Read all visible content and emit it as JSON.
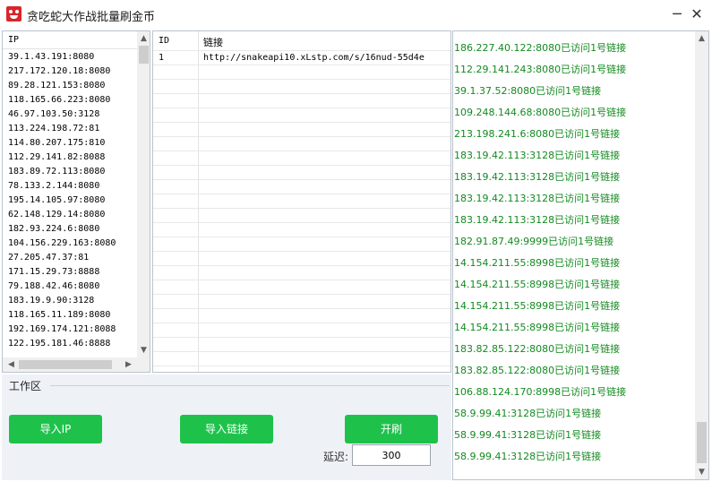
{
  "window": {
    "title": "贪吃蛇大作战批量刷金币",
    "minimize": "─",
    "close": "✕"
  },
  "ip_list": {
    "header": "IP",
    "items": [
      "39.1.43.191:8080",
      "217.172.120.18:8080",
      "89.28.121.153:8080",
      "118.165.66.223:8080",
      "46.97.103.50:3128",
      "113.224.198.72:81",
      "114.80.207.175:810",
      "112.29.141.82:8088",
      "183.89.72.113:8080",
      "78.133.2.144:8080",
      "195.14.105.97:8080",
      "62.148.129.14:8080",
      "182.93.224.6:8080",
      "104.156.229.163:8080",
      "27.205.47.37:81",
      "171.15.29.73:8888",
      "79.188.42.46:8080",
      "183.19.9.90:3128",
      "118.165.11.189:8080",
      "192.169.174.121:8088",
      "122.195.181.46:8888"
    ]
  },
  "link_grid": {
    "col_id": "ID",
    "col_link": "链接",
    "rows": [
      {
        "id": "1",
        "link": "http://snakeapi10.xLstp.com/s/16nud-55d4e"
      }
    ]
  },
  "work_area": {
    "label": "工作区",
    "import_ip_label": "导入IP",
    "import_link_label": "导入链接",
    "start_label": "开刷",
    "delay_label": "延迟:",
    "delay_value": "300"
  },
  "log": {
    "lines": [
      "186.227.40.122:8080已访问1号链接",
      "112.29.141.243:8080已访问1号链接",
      "39.1.37.52:8080已访问1号链接",
      "109.248.144.68:8080已访问1号链接",
      "213.198.241.6:8080已访问1号链接",
      "183.19.42.113:3128已访问1号链接",
      "183.19.42.113:3128已访问1号链接",
      "183.19.42.113:3128已访问1号链接",
      "183.19.42.113:3128已访问1号链接",
      "182.91.87.49:9999已访问1号链接",
      "14.154.211.55:8998已访问1号链接",
      "14.154.211.55:8998已访问1号链接",
      "14.154.211.55:8998已访问1号链接",
      "14.154.211.55:8998已访问1号链接",
      "183.82.85.122:8080已访问1号链接",
      "183.82.85.122:8080已访问1号链接",
      "106.88.124.170:8998已访问1号链接",
      "58.9.99.41:3128已访问1号链接",
      "58.9.99.41:3128已访问1号链接",
      "58.9.99.41:3128已访问1号链接"
    ],
    "text_color": "#138a20"
  },
  "colors": {
    "accent_button": "#1ec24b",
    "work_area_bg": "#eef2f7"
  }
}
